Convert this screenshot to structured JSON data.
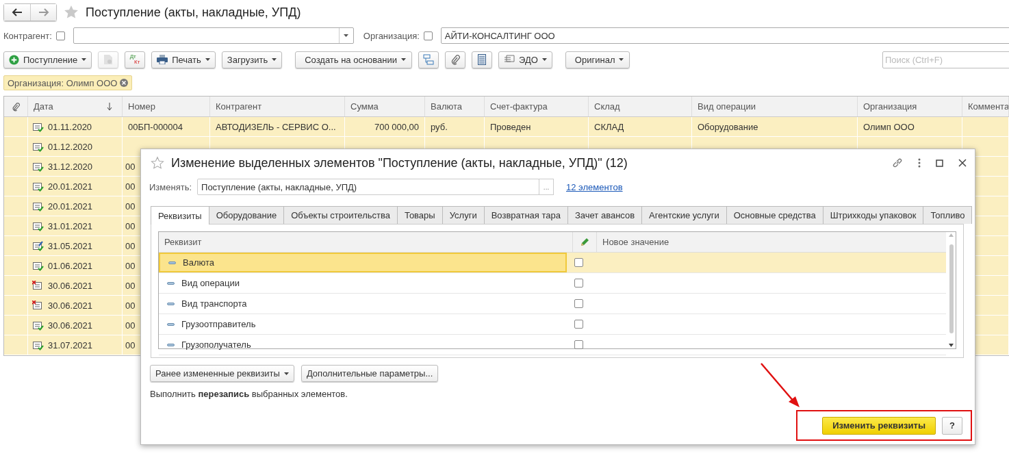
{
  "header": {
    "title": "Поступление (акты, накладные, УПД)"
  },
  "filters": {
    "counterparty": {
      "label": "Контрагент:",
      "checked": false
    },
    "organization": {
      "label": "Организация:",
      "checked": false,
      "value": "АЙТИ-КОНСАЛТИНГ ООО"
    }
  },
  "toolbar": {
    "create": "Поступление",
    "copy_disabled": true,
    "dtkt": [
      "Дт",
      "Кт"
    ],
    "print": "Печать",
    "load": "Загрузить",
    "create_based": "Создать на основании",
    "edo": "ЭДО",
    "original": "Оригинал",
    "search_placeholder": "Поиск (Ctrl+F)"
  },
  "filter_tag": "Организация: Олимп ООО",
  "table": {
    "columns": [
      "Дата",
      "Номер",
      "Контрагент",
      "Сумма",
      "Валюта",
      "Счет-фактура",
      "Склад",
      "Вид операции",
      "Организация",
      "Коммента"
    ],
    "rows": [
      {
        "kind": "posted",
        "selected": true,
        "cells": [
          "01.11.2020",
          "00БП-000004",
          "АВТОДИЗЕЛЬ - СЕРВИС О...",
          "700 000,00",
          "руб.",
          "Проведен",
          "СКЛАД",
          "Оборудование",
          "Олимп ООО"
        ]
      },
      {
        "kind": "posted",
        "selected": true,
        "cells": [
          "01.12.2020"
        ]
      },
      {
        "kind": "posted",
        "selected": true,
        "cells": [
          "31.12.2020",
          "00"
        ]
      },
      {
        "kind": "posted",
        "selected": true,
        "cells": [
          "20.01.2021",
          "00"
        ]
      },
      {
        "kind": "posted",
        "selected": true,
        "cells": [
          "20.01.2021",
          "00"
        ]
      },
      {
        "kind": "posted",
        "selected": true,
        "cells": [
          "31.01.2021",
          "00"
        ]
      },
      {
        "kind": "modified",
        "selected": true,
        "cells": [
          "31.05.2021",
          "00"
        ]
      },
      {
        "kind": "posted",
        "selected": true,
        "cells": [
          "01.06.2021",
          "00"
        ]
      },
      {
        "kind": "deleted",
        "selected": true,
        "cells": [
          "30.06.2021",
          "00"
        ]
      },
      {
        "kind": "deleted",
        "selected": true,
        "cells": [
          "30.06.2021",
          "00"
        ]
      },
      {
        "kind": "posted",
        "selected": true,
        "cells": [
          "30.06.2021",
          "00"
        ]
      },
      {
        "kind": "posted",
        "selected": true,
        "cells": [
          "31.07.2021",
          "00"
        ]
      }
    ]
  },
  "dialog": {
    "title": "Изменение выделенных элементов \"Поступление (акты, накладные, УПД)\" (12)",
    "change_label": "Изменять:",
    "change_value": "Поступление (акты, накладные, УПД)",
    "select_button": "...",
    "elements_link": "12 элементов",
    "tabs": [
      {
        "label": "Реквизиты",
        "selected": true
      },
      {
        "label": "Оборудование",
        "selected": false
      },
      {
        "label": "Объекты строительства",
        "selected": false
      },
      {
        "label": "Товары",
        "selected": false
      },
      {
        "label": "Услуги",
        "selected": false
      },
      {
        "label": "Возвратная тара",
        "selected": false
      },
      {
        "label": "Зачет авансов",
        "selected": false
      },
      {
        "label": "Агентские услуги",
        "selected": false
      },
      {
        "label": "Основные средства",
        "selected": false
      },
      {
        "label": "Штрихкоды упаковок",
        "selected": false
      },
      {
        "label": "Топливо",
        "selected": false
      }
    ],
    "attr_columns": [
      "Реквизит",
      "Новое значение"
    ],
    "attributes": [
      {
        "name": "Валюта",
        "checked": false,
        "selected": true
      },
      {
        "name": "Вид операции",
        "checked": false,
        "selected": false
      },
      {
        "name": "Вид транспорта",
        "checked": false,
        "selected": false
      },
      {
        "name": "Грузоотправитель",
        "checked": false,
        "selected": false
      },
      {
        "name": "Грузополучатель",
        "checked": false,
        "selected": false
      }
    ],
    "prev_button": "Ранее измененные реквизиты",
    "extra_button": "Дополнительные параметры...",
    "note": "Выполнить **перезапись** выбранных элементов.",
    "apply_button": "Изменить реквизиты",
    "help_button": "?"
  }
}
